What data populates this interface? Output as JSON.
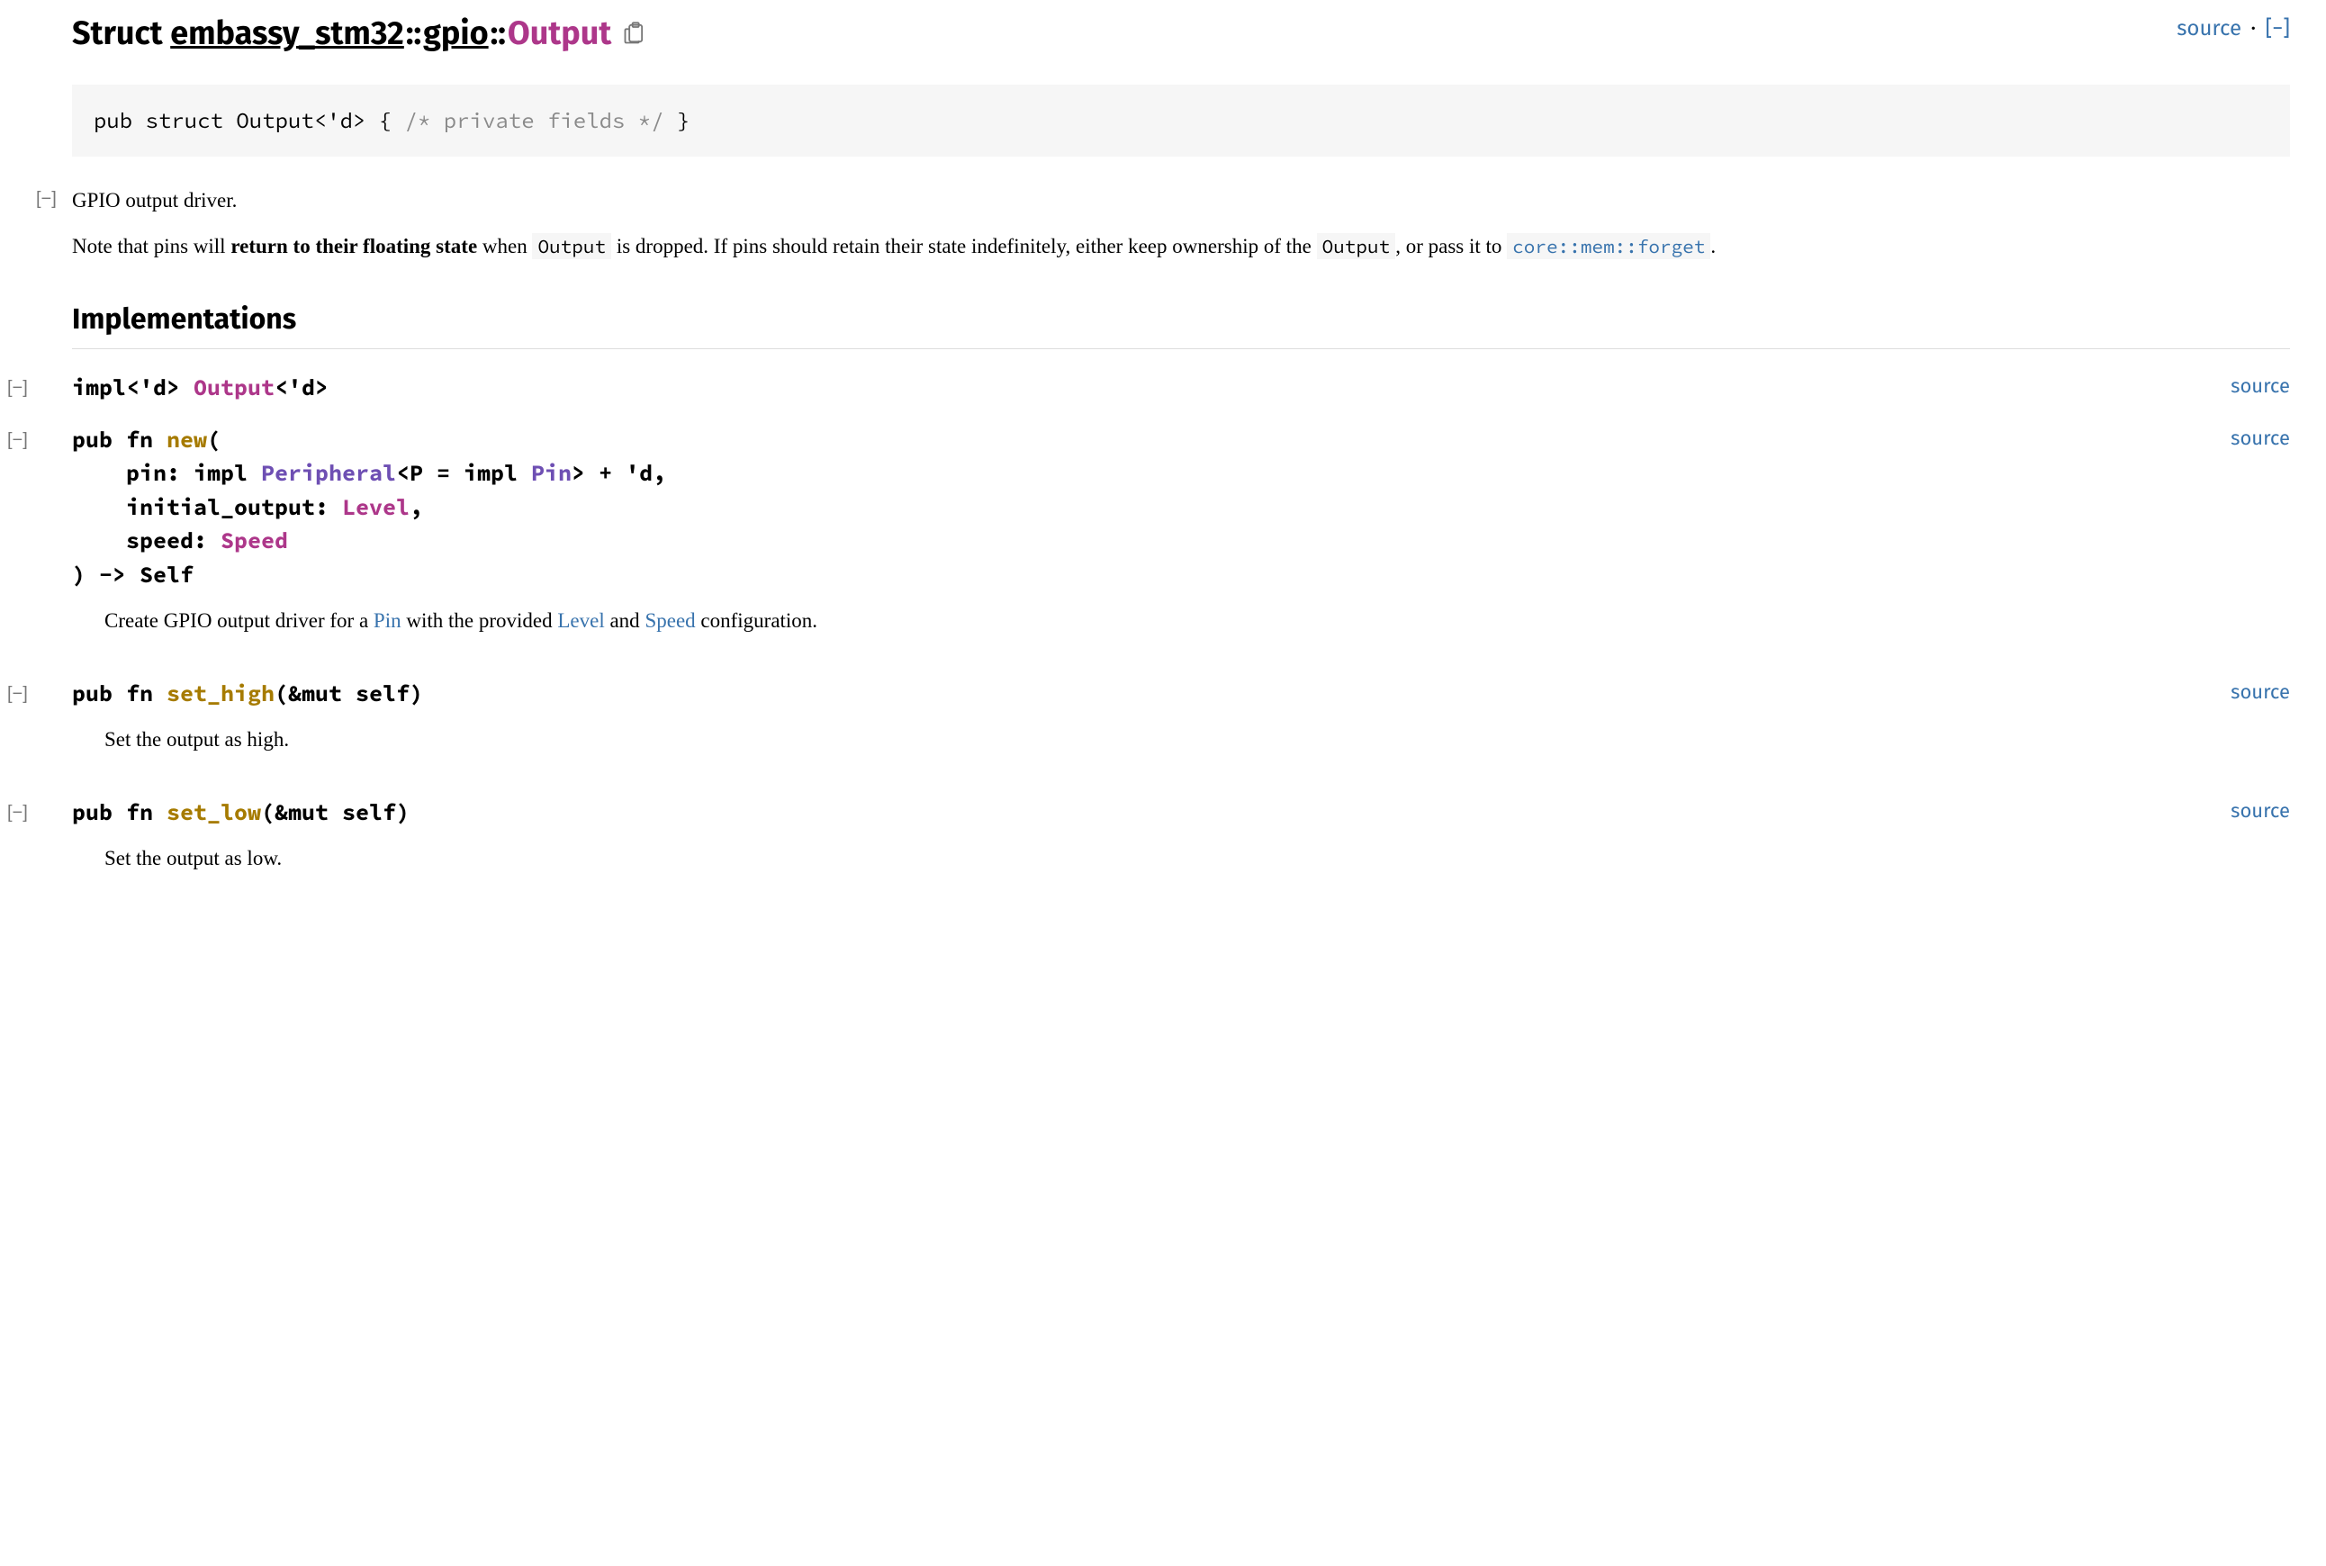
{
  "header": {
    "kind": "Struct",
    "crate": "embassy_stm32",
    "module": "gpio",
    "type_name": "Output",
    "source_label": "source",
    "collapse_label": "[−]"
  },
  "declaration": {
    "prefix": "pub struct Output<'d> { ",
    "comment": "/* private fields */",
    "suffix": " }"
  },
  "summary": "GPIO output driver.",
  "detail": {
    "pre": "Note that pins will ",
    "bold": "return to their floating state",
    "mid1": " when ",
    "code1": "Output",
    "mid2": " is dropped. If pins should retain their state indefinitely, either keep ownership of the ",
    "code2": "Output",
    "mid3": ", or pass it to ",
    "link_code": "core::mem::forget",
    "after": "."
  },
  "implementations_heading": "Implementations",
  "impl_header": {
    "text_html": "impl<'d> Output<'d>",
    "kw": "impl",
    "lt": "<'d> ",
    "type": "Output",
    "tail": "<'d>",
    "source_label": "source"
  },
  "methods": [
    {
      "id": "new",
      "sig_lines": {
        "l1a": "pub fn ",
        "l1_fn": "new",
        "l1b": "(",
        "l2a": "    pin: impl ",
        "l2_trait": "Peripheral",
        "l2b": "<P = impl ",
        "l2_trait2": "Pin",
        "l2c": "> + 'd,",
        "l3a": "    initial_output: ",
        "l3_type": "Level",
        "l3b": ",",
        "l4a": "    speed: ",
        "l4_type": "Speed",
        "l5": ") -> Self"
      },
      "source_label": "source",
      "doc": {
        "pre": "Create GPIO output driver for a ",
        "link1": "Pin",
        "mid1": " with the provided ",
        "link2": "Level",
        "mid2": " and ",
        "link3": "Speed",
        "post": " configuration."
      }
    },
    {
      "id": "set_high",
      "sig_simple": {
        "pre": "pub fn ",
        "fn": "set_high",
        "post": "(&mut self)"
      },
      "source_label": "source",
      "doc_text": "Set the output as high."
    },
    {
      "id": "set_low",
      "sig_simple": {
        "pre": "pub fn ",
        "fn": "set_low",
        "post": "(&mut self)"
      },
      "source_label": "source",
      "doc_text": "Set the output as low."
    }
  ],
  "toggle_glyph": "[−]"
}
